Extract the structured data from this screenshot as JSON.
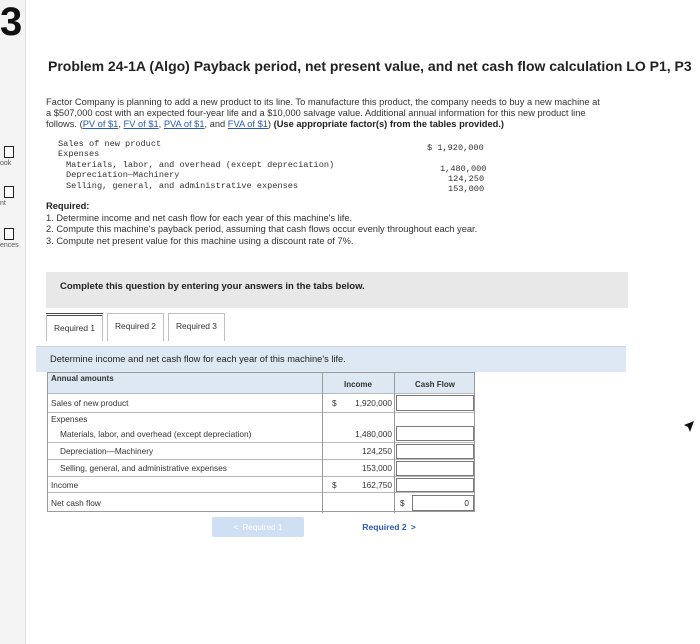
{
  "sidebar": {
    "big_char": "3",
    "items": [
      "ook",
      "nt",
      "ences"
    ]
  },
  "problem": {
    "title": "Problem 24-1A (Algo) Payback period, net present value, and net cash flow calculation LO P1, P3",
    "intro_line1": "Factor Company is planning to add a new product to its line. To manufacture this product, the company needs to buy a new machine at",
    "intro_line2": "a $507,000 cost with an expected four-year life and a $10,000 salvage value. Additional annual information for this new product line",
    "intro_line3_pre": "follows. (",
    "links": [
      "PV of $1",
      "FV of $1",
      "PVA of $1",
      "FVA of $1"
    ],
    "intro_line3_post": "(Use appropriate factor(s) from the tables provided.)"
  },
  "given": {
    "sales_label": "Sales of new product",
    "sales_value": "$ 1,920,000",
    "expenses_label": "Expenses",
    "materials_label": "Materials, labor, and overhead (except depreciation)",
    "materials_value": "1,480,000",
    "depreciation_label": "Depreciation—Machinery",
    "depreciation_value": "124,250",
    "selling_label": "Selling, general, and administrative expenses",
    "selling_value": "153,000"
  },
  "required": {
    "heading": "Required:",
    "items": [
      "1. Determine income and net cash flow for each year of this machine's life.",
      "2. Compute this machine's payback period, assuming that cash flows occur evenly throughout each year.",
      "3. Compute net present value for this machine using a discount rate of 7%."
    ]
  },
  "complete_box": "Complete this question by entering your answers in the tabs below.",
  "tabs": [
    "Required 1",
    "Required 2",
    "Required 3"
  ],
  "instruction": "Determine income and net cash flow for each year of this machine's life.",
  "table": {
    "header_label": "Annual amounts",
    "header_income": "Income",
    "header_cash": "Cash Flow",
    "rows": [
      {
        "label": "Sales of new product",
        "dollar": "$",
        "income": "1,920,000",
        "cash": ""
      },
      {
        "label": "Expenses",
        "dollar": "",
        "income": "",
        "cash": ""
      },
      {
        "label": "Materials, labor, and overhead (except depreciation)",
        "dollar": "",
        "income": "1,480,000",
        "cash": ""
      },
      {
        "label": "Depreciation—Machinery",
        "dollar": "",
        "income": "124,250",
        "cash": ""
      },
      {
        "label": "Selling, general, and administrative expenses",
        "dollar": "",
        "income": "153,000",
        "cash": ""
      },
      {
        "label": "Income",
        "dollar": "$",
        "income": "162,750",
        "cash": ""
      },
      {
        "label": "Net cash flow",
        "dollar": "",
        "income": "",
        "cash_dollar": "$",
        "cash": "0"
      }
    ]
  },
  "nav": {
    "prev": "Required 1",
    "next": "Required 2"
  }
}
